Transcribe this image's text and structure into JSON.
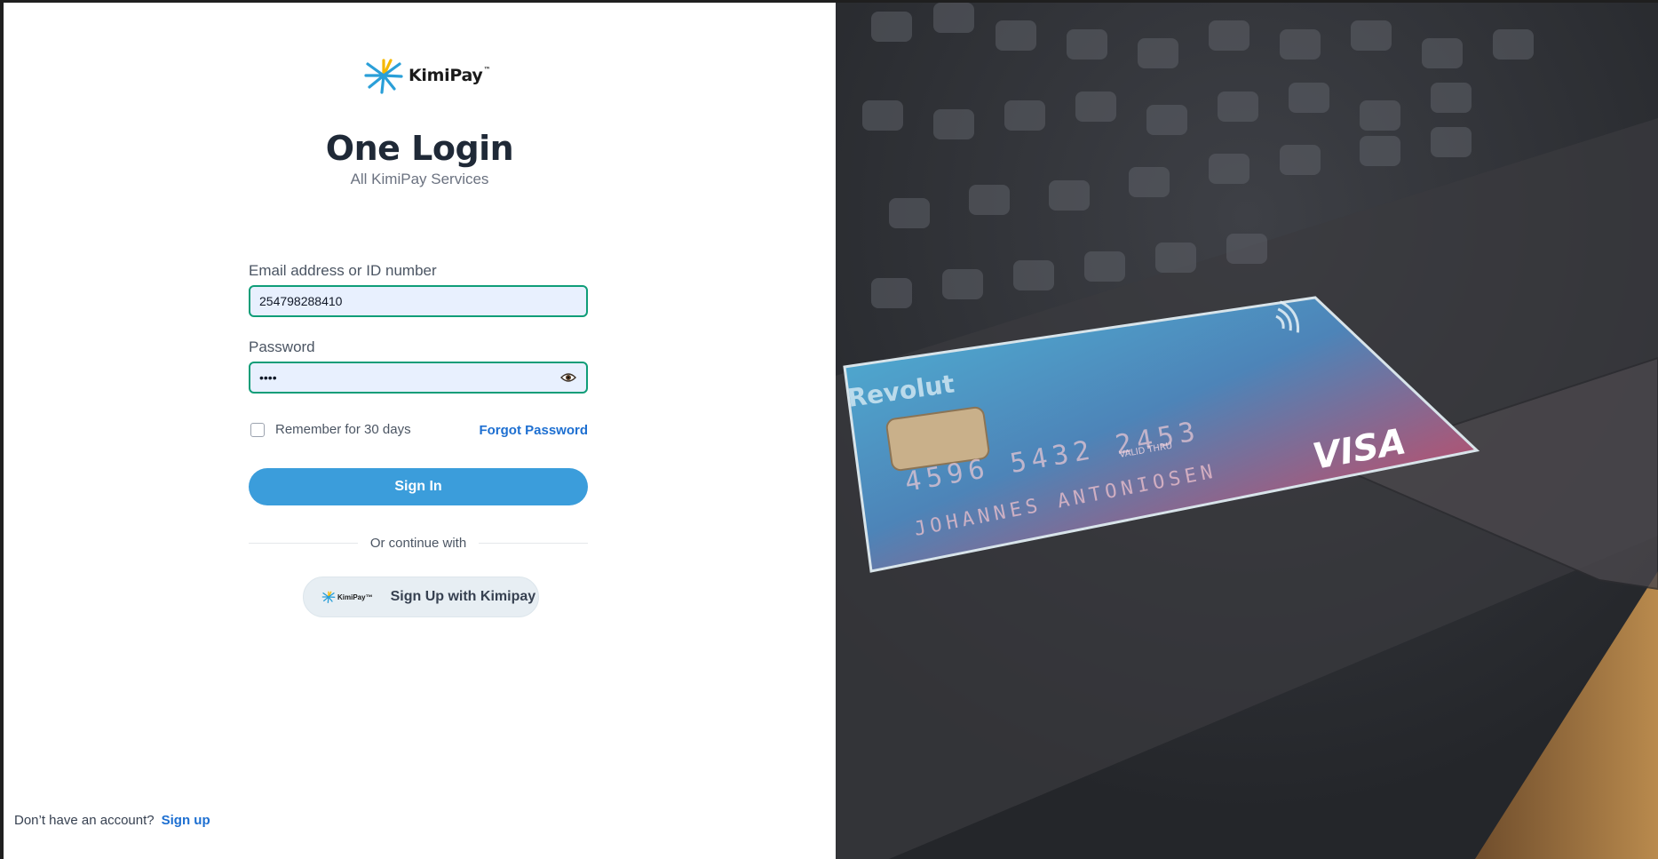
{
  "brand": {
    "name": "KimiPay",
    "tm": "™"
  },
  "header": {
    "title": "One Login",
    "subtitle": "All KimiPay Services"
  },
  "form": {
    "email_label": "Email address or ID number",
    "email_value": "254798288410",
    "password_label": "Password",
    "password_value": "••••",
    "remember_label": "Remember for 30 days",
    "remember_checked": false,
    "forgot_label": "Forgot Password",
    "signin_label": "Sign In",
    "divider_label": "Or continue with",
    "kimipay_signup_label": "Sign Up with Kimipay"
  },
  "footer": {
    "prompt": "Don’t have an account?",
    "link": "Sign up"
  },
  "hero": {
    "card_brand": "VISA",
    "card_bank": "Revolut",
    "card_number": "4596 5432 2453",
    "card_name": "JOHANNES ANTONIOSEN",
    "card_valid": "VALID THRU"
  },
  "colors": {
    "accent": "#3b9ddb",
    "field_border": "#0f9d78",
    "link": "#1d6fd1"
  }
}
